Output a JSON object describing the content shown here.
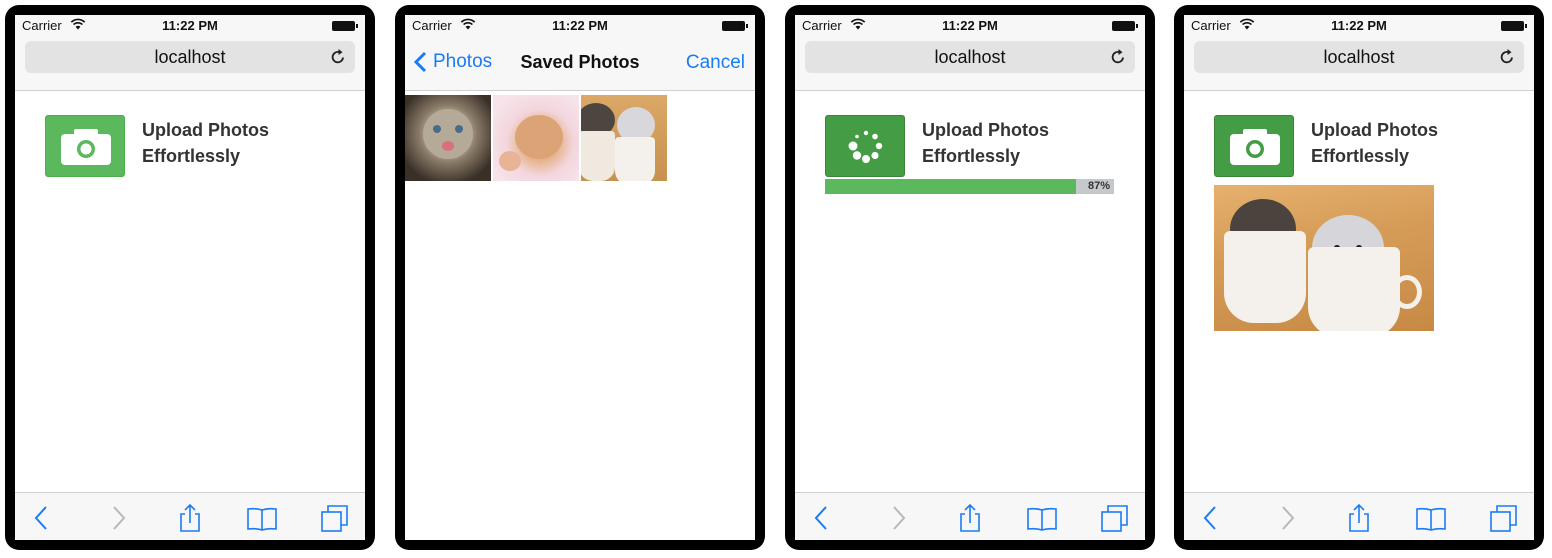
{
  "status_bar": {
    "carrier": "Carrier",
    "time": "11:22 PM"
  },
  "colors": {
    "accent_blue": "#1a7cf5",
    "success_green": "#5cb85c",
    "success_green_active": "#449d44",
    "disabled_gray": "#b8b8b8"
  },
  "screens": [
    {
      "id": "initial",
      "url": "localhost",
      "upload": {
        "title_line1": "Upload Photos",
        "title_line2": "Effortlessly",
        "icon": "camera-icon"
      },
      "toolbar": {
        "back": "chevron-left-icon",
        "forward": "chevron-right-icon",
        "share": "share-icon",
        "bookmarks": "book-icon",
        "tabs": "tabs-icon"
      }
    },
    {
      "id": "picker",
      "nav": {
        "back_label": "Photos",
        "title": "Saved Photos",
        "cancel_label": "Cancel"
      },
      "photos": [
        {
          "name": "tabby-kitten-photo"
        },
        {
          "name": "sleeping-kitten-photo"
        },
        {
          "name": "kittens-in-cups-photo"
        }
      ]
    },
    {
      "id": "uploading",
      "url": "localhost",
      "upload": {
        "title_line1": "Upload Photos",
        "title_line2": "Effortlessly",
        "icon": "spinner-icon"
      },
      "progress": {
        "percent": 87,
        "label": "87%"
      }
    },
    {
      "id": "done",
      "url": "localhost",
      "upload": {
        "title_line1": "Upload Photos",
        "title_line2": "Effortlessly",
        "icon": "camera-icon"
      },
      "uploaded_photo": {
        "name": "kittens-in-cups-photo"
      }
    }
  ]
}
